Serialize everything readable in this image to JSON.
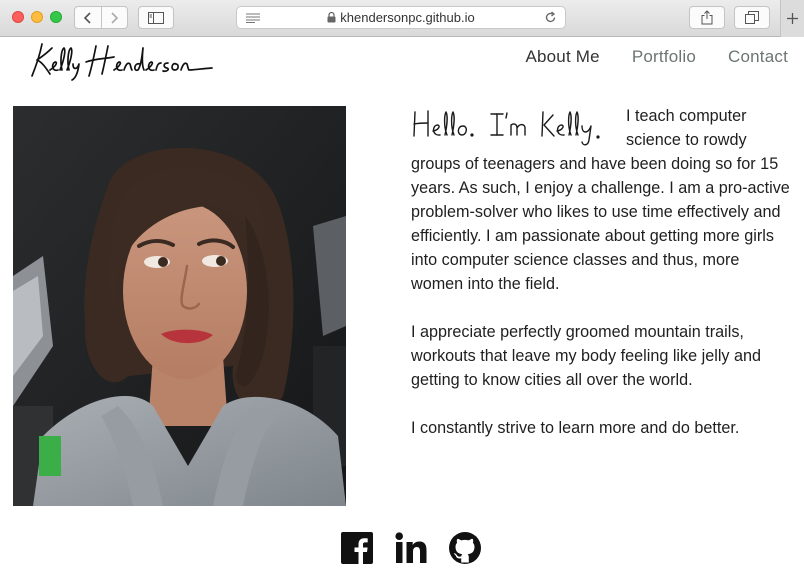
{
  "browser": {
    "url": "khendersonpc.github.io",
    "icons": [
      "back-icon",
      "forward-icon",
      "sidebar-icon",
      "reader-icon",
      "lock-icon",
      "reload-icon",
      "share-icon",
      "tabs-icon",
      "new-tab-icon"
    ]
  },
  "site": {
    "logo_text": "Kelly Henderson",
    "nav": {
      "about": "About Me",
      "portfolio": "Portfolio",
      "contact": "Contact"
    },
    "colors": {
      "nav_active": "#333333",
      "nav_inactive": "#6d7474"
    }
  },
  "bio": {
    "greeting": "Hello. I'm Kelly.",
    "intro": "I teach computer science to rowdy groups of teenagers and have been doing so for 15 years. As such, I enjoy a challenge. I am a pro-active problem-solver who likes to use time effectively and efficiently. I am passionate about getting more girls into computer science classes and thus, more women into the field.",
    "para2": "I appreciate perfectly groomed mountain trails, workouts that leave my body feeling like jelly and getting to know cities all over the world.",
    "para3": "I constantly strive to learn more and do better."
  },
  "social": {
    "icons": [
      "facebook-icon",
      "linkedin-icon",
      "github-icon"
    ]
  }
}
